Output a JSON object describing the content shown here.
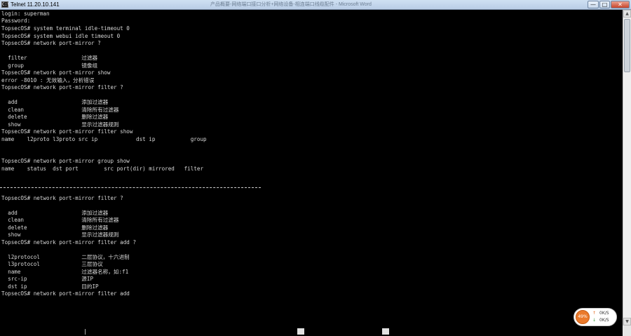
{
  "window": {
    "title": "Telnet 11.20.10.141",
    "icon_label": "C:\\",
    "background_title": "产品概要-网络端口接口分析+网络设备-相连端口线缆配件 - Microsoft Word",
    "buttons": {
      "minimize": "—",
      "maximize": "□",
      "close": "✕"
    }
  },
  "terminal": {
    "lines": [
      "login: superman",
      "Password:",
      "TopsecOS# system terminal idle-timeout 0",
      "TopsecOS# system webui idle timeout 0",
      "TopsecOS# network port-mirror ?",
      "",
      "  filter                 过滤器",
      "  group                  镜像组",
      "TopsecOS# network port-mirror show",
      "error -8010 : 无效输入，分析错误",
      "TopsecOS# network port-mirror filter ?",
      "",
      "  add                    添加过滤器",
      "  clean                  清除所有过滤器",
      "  delete                 删除过滤器",
      "  show                   显示过滤器规则",
      "TopsecOS# network port-mirror filter show",
      "name    l2proto l3proto src ip            dst ip           group",
      "",
      "",
      "TopsecOS# network port-mirror group show",
      "name    status  dst port        src port(dir) mirrored   filter",
      "",
      "",
      "",
      "TopsecOS# network port-mirror filter ?",
      "",
      "  add                    添加过滤器",
      "  clean                  清除所有过滤器",
      "  delete                 删除过滤器",
      "  show                   显示过滤器规则",
      "TopsecOS# network port-mirror filter add ?",
      "",
      "  l2protocol             二层协议，十六进制",
      "  l3protocol             三层协议",
      "  name                   过滤器名称，如:f1",
      "  src-ip                 源IP",
      "  dst ip                 目的IP",
      "TopsecOS# network port-mirror filter add"
    ]
  },
  "scrollbar": {
    "up": "▲",
    "down": "▼"
  },
  "net_widget": {
    "cpu_label": "49%",
    "up_arrow": "↑",
    "down_arrow": "↓",
    "upload_speed": "0K/S",
    "download_speed": "0K/S"
  }
}
